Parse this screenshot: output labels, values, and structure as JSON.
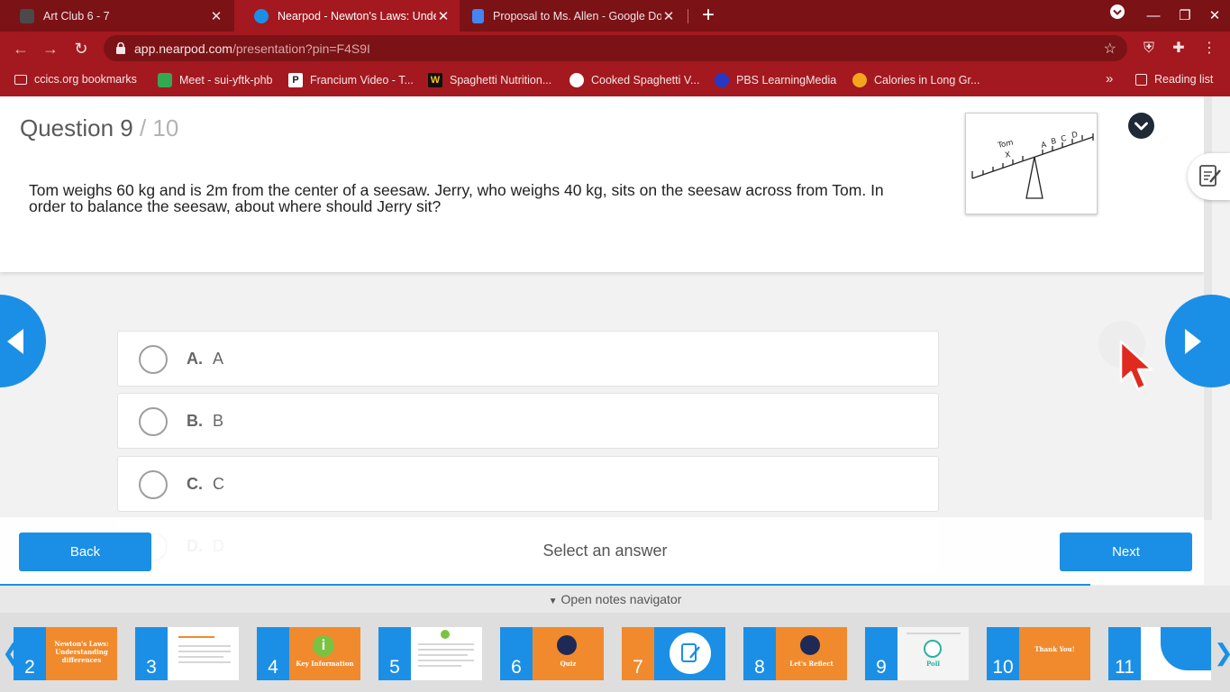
{
  "browser": {
    "tabs": [
      {
        "title": "Art Club 6 - 7",
        "active": false
      },
      {
        "title": "Nearpod - Newton's Laws: Under",
        "active": true
      },
      {
        "title": "Proposal to Ms. Allen - Google Do",
        "active": false
      }
    ],
    "url_host": "app.nearpod.com",
    "url_path": "/presentation?pin=F4S9I",
    "bookmarks": [
      "ccics.org bookmarks",
      "Meet - sui-yftk-phb",
      "Francium Video - T...",
      "Spaghetti Nutrition...",
      "Cooked Spaghetti V...",
      "PBS LearningMedia",
      "Calories in Long Gr..."
    ],
    "bookmarks_overflow": "»",
    "reading_list": "Reading list"
  },
  "question": {
    "label": "Question 9",
    "total": "/ 10",
    "text": "Tom weighs 60 kg and is 2m from the center of a seesaw. Jerry, who weighs 40 kg, sits on the seesaw across from Tom. In order to balance the seesaw, about where should Jerry sit?",
    "image_labels": {
      "tom": "Tom",
      "x": "X",
      "a": "A",
      "b": "B",
      "c": "C",
      "d": "D"
    }
  },
  "options": [
    {
      "letter": "A.",
      "text": "A"
    },
    {
      "letter": "B.",
      "text": "B"
    },
    {
      "letter": "C.",
      "text": "C"
    },
    {
      "letter": "D.",
      "text": "D"
    }
  ],
  "footer": {
    "back": "Back",
    "prompt": "Select an answer",
    "next": "Next"
  },
  "notes_navigator": "Open notes navigator",
  "slides": [
    {
      "num": "2",
      "label": "Newton's Laws: Understanding differences",
      "color": "#f08a2c",
      "current": false
    },
    {
      "num": "3",
      "label": "",
      "color": "#ffffff",
      "current": false
    },
    {
      "num": "4",
      "label": "Key Information",
      "color": "#f08a2c",
      "current": false
    },
    {
      "num": "5",
      "label": "",
      "color": "#ffffff",
      "current": false
    },
    {
      "num": "6",
      "label": "Quiz",
      "color": "#f08a2c",
      "current": false
    },
    {
      "num": "7",
      "label": "",
      "color": "#1b8fe6",
      "current": true
    },
    {
      "num": "8",
      "label": "Let's Reflect",
      "color": "#f08a2c",
      "current": false
    },
    {
      "num": "9",
      "label": "Poll",
      "color": "#f2f2f2",
      "current": false
    },
    {
      "num": "10",
      "label": "Thank You!",
      "color": "#f08a2c",
      "current": false
    },
    {
      "num": "11",
      "label": "",
      "color": "#1b8fe6",
      "current": false
    }
  ],
  "colors": {
    "accent": "#1b8fe6",
    "chrome": "#a3191f",
    "slide_orange": "#f08a2c",
    "cursor": "#e02a1f"
  }
}
